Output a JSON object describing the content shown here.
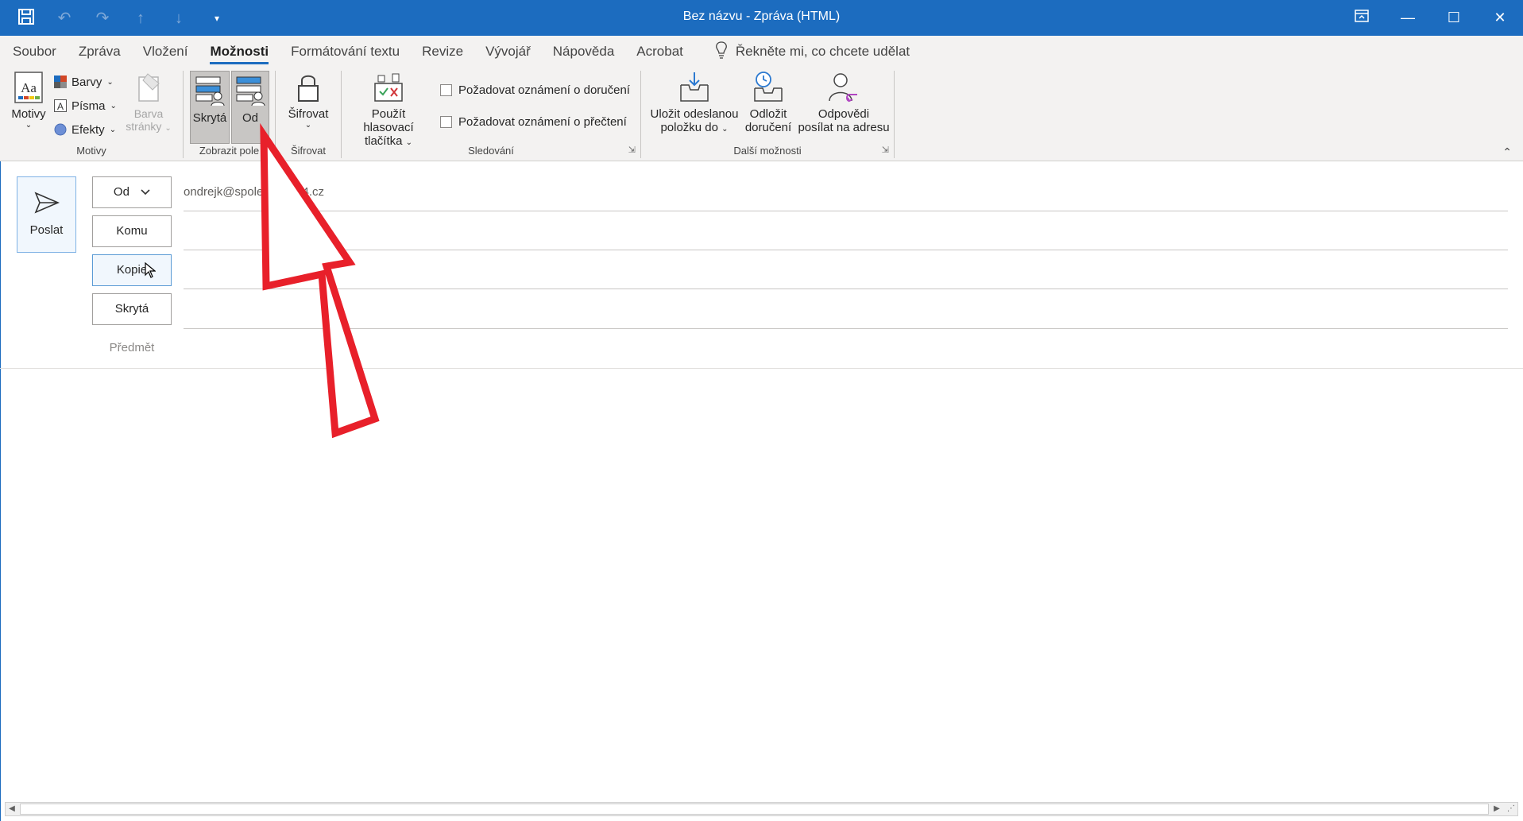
{
  "window": {
    "title": "Bez názvu  -  Zpráva (HTML)"
  },
  "tabs": [
    "Soubor",
    "Zpráva",
    "Vložení",
    "Možnosti",
    "Formátování textu",
    "Revize",
    "Vývojář",
    "Nápověda",
    "Acrobat"
  ],
  "active_tab": "Možnosti",
  "tell_me": "Řekněte mi, co chcete udělat",
  "ribbon": {
    "motivy": {
      "label": "Motivy",
      "motivy_btn": "Motivy",
      "barvy": "Barvy",
      "pisma": "Písma",
      "efekty": "Efekty",
      "barva_line1": "Barva",
      "barva_line2": "stránky"
    },
    "zobrazit_pole": {
      "label": "Zobrazit pole",
      "skryta": "Skrytá",
      "od": "Od"
    },
    "sifrovat": {
      "label": "Šifrovat",
      "btn": "Šifrovat"
    },
    "sledovani": {
      "label": "Sledování",
      "hlasovaci_line1": "Použít hlasovací",
      "hlasovaci_line2": "tlačítka",
      "doruceni": "Požadovat oznámení o doručení",
      "precteni": "Požadovat oznámení o přečtení"
    },
    "dalsi": {
      "label": "Další možnosti",
      "ulozit_line1": "Uložit odeslanou",
      "ulozit_line2": "položku do",
      "odlozit_line1": "Odložit",
      "odlozit_line2": "doručení",
      "odpovedi_line1": "Odpovědi",
      "odpovedi_line2": "posílat na adresu"
    }
  },
  "compose": {
    "send": "Poslat",
    "from_btn": "Od",
    "from_value": "ondrejk@spolecnost-24.cz",
    "to_btn": "Komu",
    "cc_btn": "Kopie",
    "bcc_btn": "Skrytá",
    "subject_label": "Předmět"
  },
  "colors": {
    "titlebar": "#1c6cbf",
    "ribbon": "#f3f2f1",
    "annotation_arrow": "#e8202a"
  }
}
